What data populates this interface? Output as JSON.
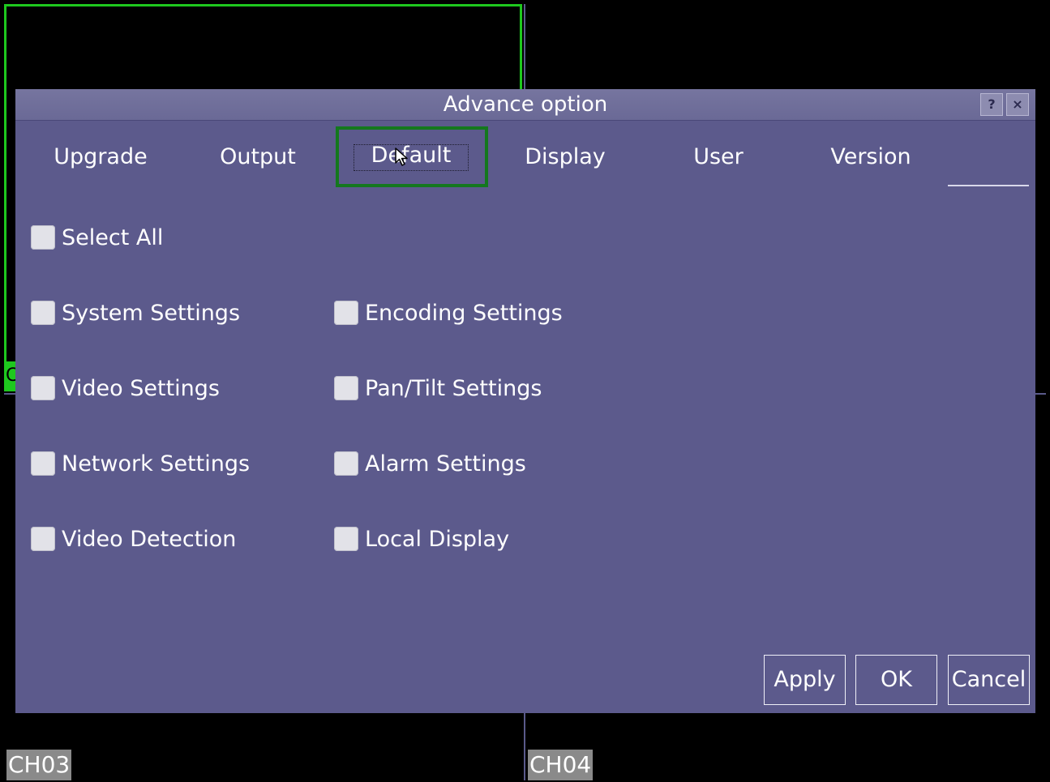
{
  "dialog": {
    "title": "Advance option",
    "help_label": "?",
    "close_label": "×"
  },
  "tabs": [
    {
      "label": "Upgrade"
    },
    {
      "label": "Output"
    },
    {
      "label": "Default"
    },
    {
      "label": "Display"
    },
    {
      "label": "User"
    },
    {
      "label": "Version"
    }
  ],
  "selected_tab": "Default",
  "checkboxes": {
    "select_all": "Select All",
    "system_settings": "System Settings",
    "encoding_settings": "Encoding Settings",
    "video_settings": "Video Settings",
    "pan_tilt_settings": "Pan/Tilt Settings",
    "network_settings": "Network Settings",
    "alarm_settings": "Alarm Settings",
    "video_detection": "Video Detection",
    "local_display": "Local Display"
  },
  "buttons": {
    "apply": "Apply",
    "ok": "OK",
    "cancel": "Cancel"
  },
  "channels": {
    "ch1_partial": "C",
    "ch3": "CH03",
    "ch4": "CH04"
  },
  "colors": {
    "dialog_bg": "#5c5a8c",
    "selected_channel_border": "#1ec81e",
    "tab_highlight": "#14781e"
  }
}
